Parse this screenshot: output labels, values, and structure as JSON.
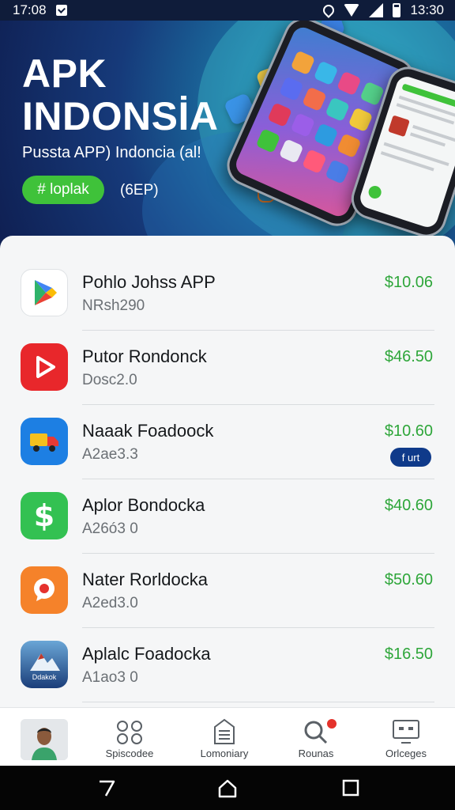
{
  "status_bar": {
    "time_left": "17:08",
    "time_right": "13:30"
  },
  "hero": {
    "title_line1": "APK",
    "title_line2": "INDONSİA",
    "subtitle": "Pussta APP) Indoncia (al!",
    "button_label": "# loplak",
    "tag_text": "(6EP)"
  },
  "apps": [
    {
      "name": "Pohlo Johss APP",
      "sub": "NRsh290",
      "price": "$10.06",
      "icon": "play-store-icon"
    },
    {
      "name": "Putor Rondonck",
      "sub": "Dosc2.0",
      "price": "$46.50",
      "icon": "play-video-icon"
    },
    {
      "name": "Naaak Foadoock",
      "sub": "A2ae3.3",
      "price": "$10.60",
      "icon": "delivery-truck-icon",
      "badge": "f urt"
    },
    {
      "name": "Aplor Bondocka",
      "sub": "A26ó3 0",
      "price": "$40.60",
      "icon": "dollar-icon"
    },
    {
      "name": "Nater Rorldocka",
      "sub": "A2ed3.0",
      "price": "$50.60",
      "icon": "map-pin-icon"
    },
    {
      "name": "Aplalc Foadocka",
      "sub": "A1ao3 0",
      "price": "$16.50",
      "icon": "mountain-logo-icon",
      "icon_text": "Ddakok"
    }
  ],
  "bottom_nav": {
    "items": [
      {
        "label": "Spiscodee",
        "icon": "grid-icon"
      },
      {
        "label": "Lomoniary",
        "icon": "document-icon"
      },
      {
        "label": "Rounas",
        "icon": "search-icon"
      },
      {
        "label": "Orlceges",
        "icon": "monitor-icon"
      }
    ]
  },
  "colors": {
    "accent_green": "#3fc23a",
    "price_green": "#2ea63a",
    "hero_dark": "#0f1f52",
    "badge_blue": "#0f3a8a"
  }
}
